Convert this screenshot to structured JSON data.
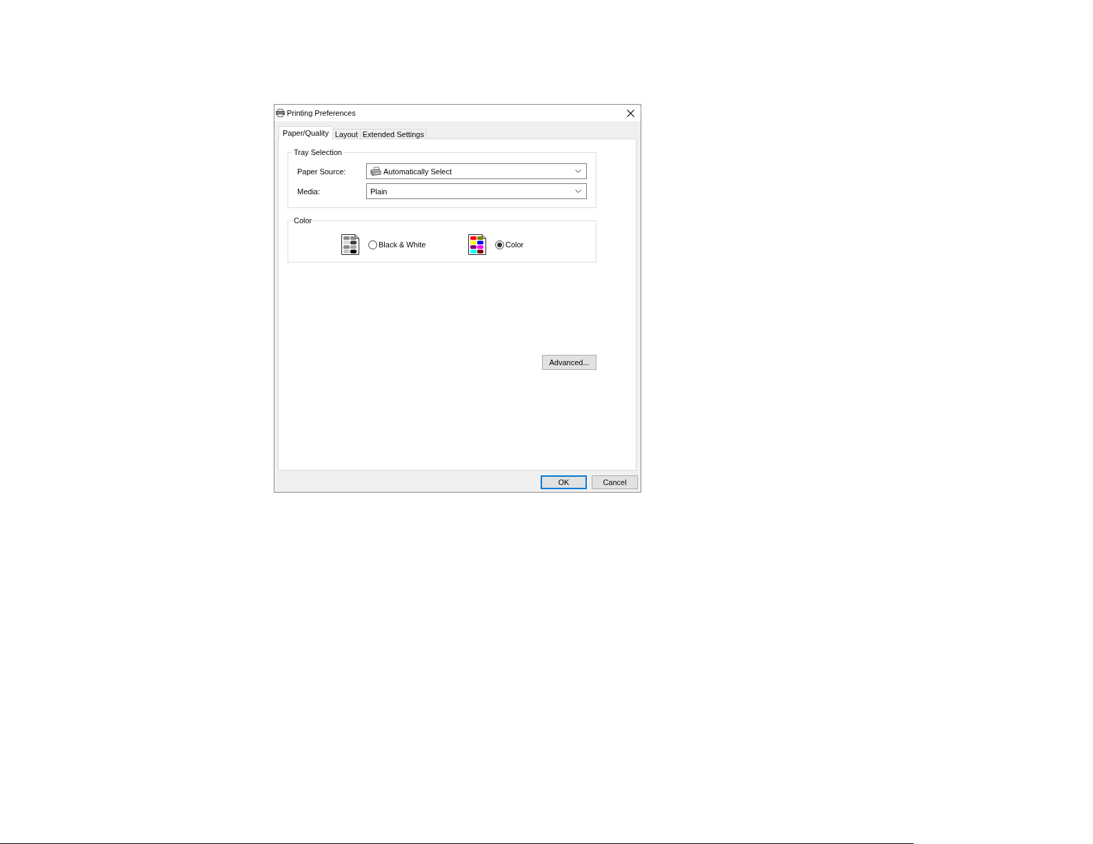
{
  "window": {
    "title": "Printing Preferences"
  },
  "tabs": [
    {
      "label": "Paper/Quality",
      "selected": true
    },
    {
      "label": "Layout",
      "selected": false
    },
    {
      "label": "Extended Settings",
      "selected": false
    }
  ],
  "tray_selection": {
    "title": "Tray Selection",
    "fields": [
      {
        "label": "Paper Source:",
        "value": "Automatically Select",
        "kind": "icon"
      },
      {
        "label": "Media:",
        "value": "Plain",
        "kind": "text"
      }
    ]
  },
  "color": {
    "title": "Color",
    "options": [
      {
        "label": "Black & White",
        "kind": "mono",
        "selected": false
      },
      {
        "label": "Color",
        "kind": "color",
        "selected": true
      }
    ]
  },
  "advanced_button": {
    "label": "Advanced..."
  },
  "buttons": [
    {
      "label": "OK",
      "default": true
    },
    {
      "label": "Cancel",
      "default": false
    }
  ]
}
